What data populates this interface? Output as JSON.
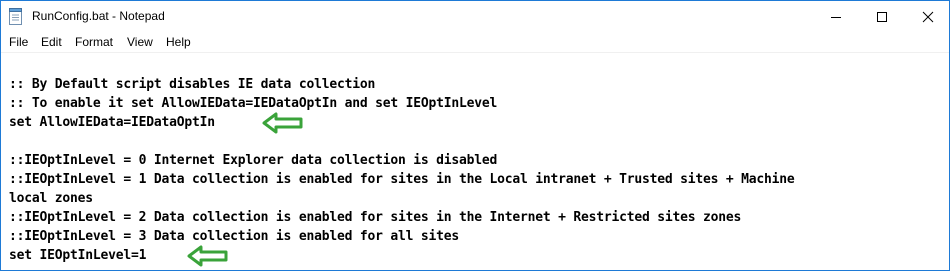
{
  "window": {
    "title": "RunConfig.bat - Notepad",
    "app_icon": "notepad-icon",
    "controls": [
      "minimize-icon",
      "maximize-icon",
      "close-icon"
    ]
  },
  "menu": {
    "items": [
      "File",
      "Edit",
      "Format",
      "View",
      "Help"
    ]
  },
  "editor": {
    "lines": [
      ":: By Default script disables IE data collection",
      ":: To enable it set AllowIEData=IEDataOptIn and set IEOptInLevel",
      "set AllowIEData=IEDataOptIn",
      "",
      "::IEOptInLevel = 0 Internet Explorer data collection is disabled",
      "::IEOptInLevel = 1 Data collection is enabled for sites in the Local intranet + Trusted sites + Machine",
      "local zones",
      "::IEOptInLevel = 2 Data collection is enabled for sites in the Internet + Restricted sites zones",
      "::IEOptInLevel = 3 Data collection is enabled for all sites",
      "set IEOptInLevel=1"
    ],
    "annotation_icon": "green-arrow-left-icon",
    "annotation_color": "#3aa33a"
  }
}
